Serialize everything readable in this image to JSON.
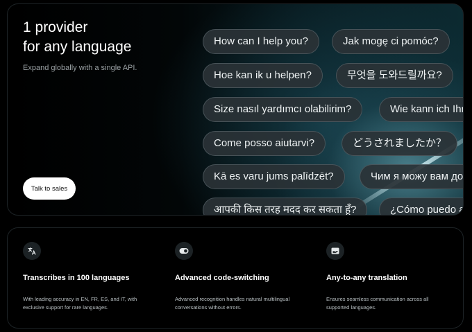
{
  "hero": {
    "title_line1": "1 provider",
    "title_line2": "for any language",
    "subtitle": "Expand globally with a single API.",
    "cta_label": "Talk to sales"
  },
  "phrases": [
    "How can I help you?",
    "Jak mogę ci pomóc?",
    "Hoe kan ik u helpen?",
    "무엇을 도와드릴까요?",
    "Size nasıl yardımcı olabilirim?",
    "Wie kann ich Ihnen helfen?",
    "Come posso aiutarvi?",
    "どうされましたか？",
    "Kā es varu jums palīdzēt?",
    "Чим я можу вам допомогти?",
    "आपकी किस तरह मदद कर सकता हूँ?",
    "¿Cómo puedo ayudarte?"
  ],
  "features": [
    {
      "icon": "translate-icon",
      "title": "Transcribes in 100 languages",
      "desc": "With leading accuracy in EN, FR, ES, and IT, with exclusive support for rare languages."
    },
    {
      "icon": "toggle-switch-icon",
      "title": "Advanced code-switching",
      "desc": "Advanced recognition handles natural multilingual conversations without errors."
    },
    {
      "icon": "subtitles-icon",
      "title": "Any-to-any translation",
      "desc": "Ensures seamless communication across all supported languages."
    }
  ],
  "colors": {
    "background": "#000000",
    "chip_bg": "#2a3236",
    "accent_glow": "#78bec9"
  }
}
